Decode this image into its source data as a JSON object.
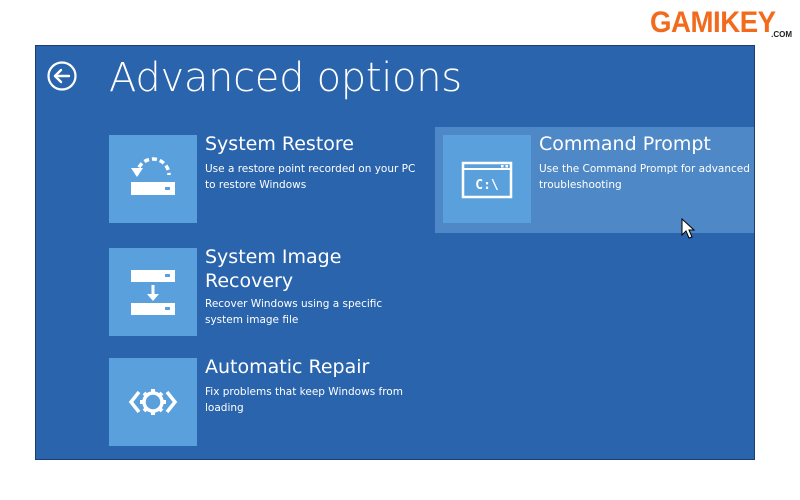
{
  "watermark": {
    "brand": "GAMIKEY",
    "domain": ".COM"
  },
  "page": {
    "title": "Advanced options"
  },
  "options": [
    {
      "id": "system-restore",
      "title": "System Restore",
      "description": "Use a restore point recorded on your PC to restore Windows",
      "icon": "system-restore-icon"
    },
    {
      "id": "system-image-recovery",
      "title": "System Image Recovery",
      "description": "Recover Windows using a specific system image file",
      "icon": "system-image-icon"
    },
    {
      "id": "automatic-repair",
      "title": "Automatic Repair",
      "description": "Fix problems that keep Windows from loading",
      "icon": "repair-gear-icon"
    },
    {
      "id": "command-prompt",
      "title": "Command Prompt",
      "description": "Use the Command Prompt for advanced troubleshooting",
      "icon": "command-prompt-icon",
      "tile_text": "C:\\"
    }
  ],
  "colors": {
    "background": "#2a64ad",
    "tile": "#5aa0dc",
    "highlight": "#4f88c6",
    "text": "#ffffff",
    "watermark": "#f26b1d"
  }
}
